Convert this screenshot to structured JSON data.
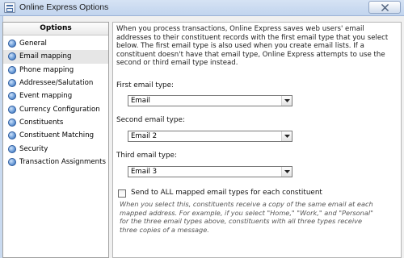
{
  "window": {
    "title": "Online Express Options",
    "close_icon": "close-icon"
  },
  "sidebar": {
    "header": "Options",
    "selected_index": 1,
    "items": [
      {
        "label": "General",
        "icon": "bullet-icon"
      },
      {
        "label": "Email mapping",
        "icon": "bullet-icon"
      },
      {
        "label": "Phone mapping",
        "icon": "bullet-icon"
      },
      {
        "label": "Addressee/Salutation",
        "icon": "bullet-icon"
      },
      {
        "label": "Event mapping",
        "icon": "bullet-icon"
      },
      {
        "label": "Currency Configuration",
        "icon": "bullet-icon"
      },
      {
        "label": "Constituents",
        "icon": "bullet-icon"
      },
      {
        "label": "Constituent Matching",
        "icon": "bullet-icon"
      },
      {
        "label": "Security",
        "icon": "bullet-icon"
      },
      {
        "label": "Transaction Assignments",
        "icon": "bullet-icon"
      }
    ]
  },
  "main": {
    "intro": "When you process transactions, Online Express saves web users' email addresses to their constituent records with the first email type that you select below. The first email type is also used when you create email lists. If a constituent doesn't have that email type, Online Express attempts to use the second or third email type instead.",
    "first_label": "First email type:",
    "first_value": "Email",
    "second_label": "Second email type:",
    "second_value": "Email 2",
    "third_label": "Third email type:",
    "third_value": "Email 3",
    "checkbox_label": "Send to ALL mapped email types for each constituent",
    "checkbox_checked": false,
    "note": "When you select this, constituents receive a copy of the same email at each mapped address. For example, if you select \"Home,\" \"Work,\" and \"Personal\" for the three email types above, constituents with all three types receive three copies of a message."
  },
  "colors": {
    "titlebar": "#c9daf0",
    "selected_item": "#e6e6e6",
    "bullet": "#3d72c4"
  }
}
